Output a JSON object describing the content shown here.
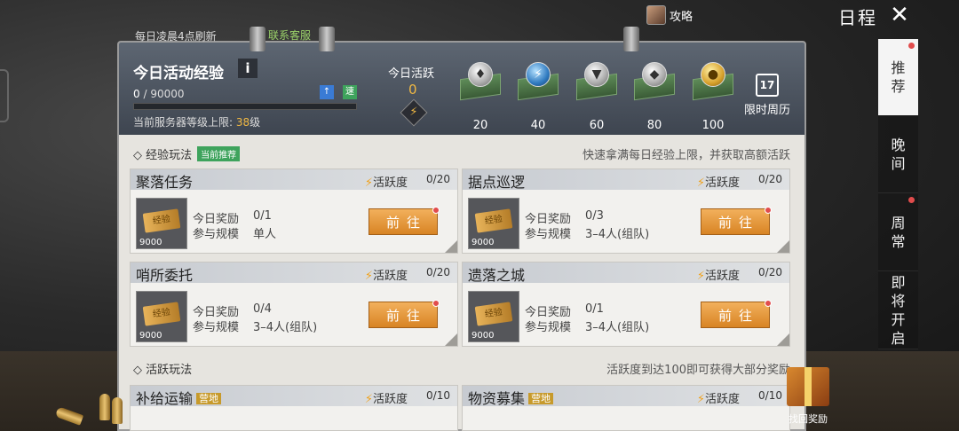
{
  "top": {
    "strategy_label": "攻略",
    "title": "日程",
    "close_symbol": "✕"
  },
  "side_tabs": [
    {
      "label": "推荐",
      "active": true,
      "dot": true
    },
    {
      "label": "晚间",
      "active": false,
      "dot": false
    },
    {
      "label": "周常",
      "active": false,
      "dot": true
    },
    {
      "label": "即将开启",
      "active": false,
      "dot": false
    }
  ],
  "header": {
    "refresh_note": "每日凌晨4点刷新",
    "contact_cs": "联系客服",
    "exp_title": "今日活动经验",
    "info_symbol": "i",
    "exp_current": "0",
    "exp_max": "/ 90000",
    "badge_1": "↑",
    "badge_2": "速",
    "server_cap_label": "当前服务器等级上限:",
    "server_cap_level": "38",
    "server_cap_unit": "级",
    "today_active_label": "今日活跃",
    "today_active_value": "0",
    "week_limit_day": "17",
    "week_limit_label": "限时周历"
  },
  "chests": [
    {
      "threshold": "20",
      "icon": "silver-coin-icon",
      "glyph": "♦"
    },
    {
      "threshold": "40",
      "icon": "blue-bolt-icon",
      "glyph": "⚡"
    },
    {
      "threshold": "60",
      "icon": "badge-icon",
      "glyph": "▼"
    },
    {
      "threshold": "80",
      "icon": "armor-icon",
      "glyph": "◆"
    },
    {
      "threshold": "100",
      "icon": "gold-coin-icon",
      "glyph": "●"
    }
  ],
  "sections": {
    "exp": {
      "title": "◇ 经验玩法",
      "tag": "当前推荐",
      "hint": "快速拿满每日经验上限，并获取高额活跃"
    },
    "active": {
      "title": "◇ 活跃玩法",
      "hint": "活跃度到达100即可获得大部分奖励"
    }
  },
  "labels": {
    "activity": "活跃度",
    "today_reward": "今日奖励",
    "scale": "参与规模",
    "go": "前往",
    "ticket_text": "经验",
    "ticket_num": "9000",
    "base_tag": "营地"
  },
  "cards": [
    {
      "title": "聚落任务",
      "activity": "0/20",
      "reward": "0/1",
      "scale": "单人"
    },
    {
      "title": "据点巡逻",
      "activity": "0/20",
      "reward": "0/3",
      "scale": "3–4人(组队)"
    },
    {
      "title": "哨所委托",
      "activity": "0/20",
      "reward": "0/4",
      "scale": "3–4人(组队)"
    },
    {
      "title": "遗落之城",
      "activity": "0/20",
      "reward": "0/1",
      "scale": "3–4人(组队)"
    },
    {
      "title": "补给运输",
      "activity": "0/10",
      "tag": "营地"
    },
    {
      "title": "物资募集",
      "activity": "0/10",
      "tag": "营地"
    }
  ],
  "gift": {
    "label": "找回奖励"
  },
  "colors": {
    "accent_orange": "#d88424",
    "activity_yellow": "#f0b843",
    "green_tag": "#3ea35c",
    "red_dot": "#e14c4c"
  }
}
